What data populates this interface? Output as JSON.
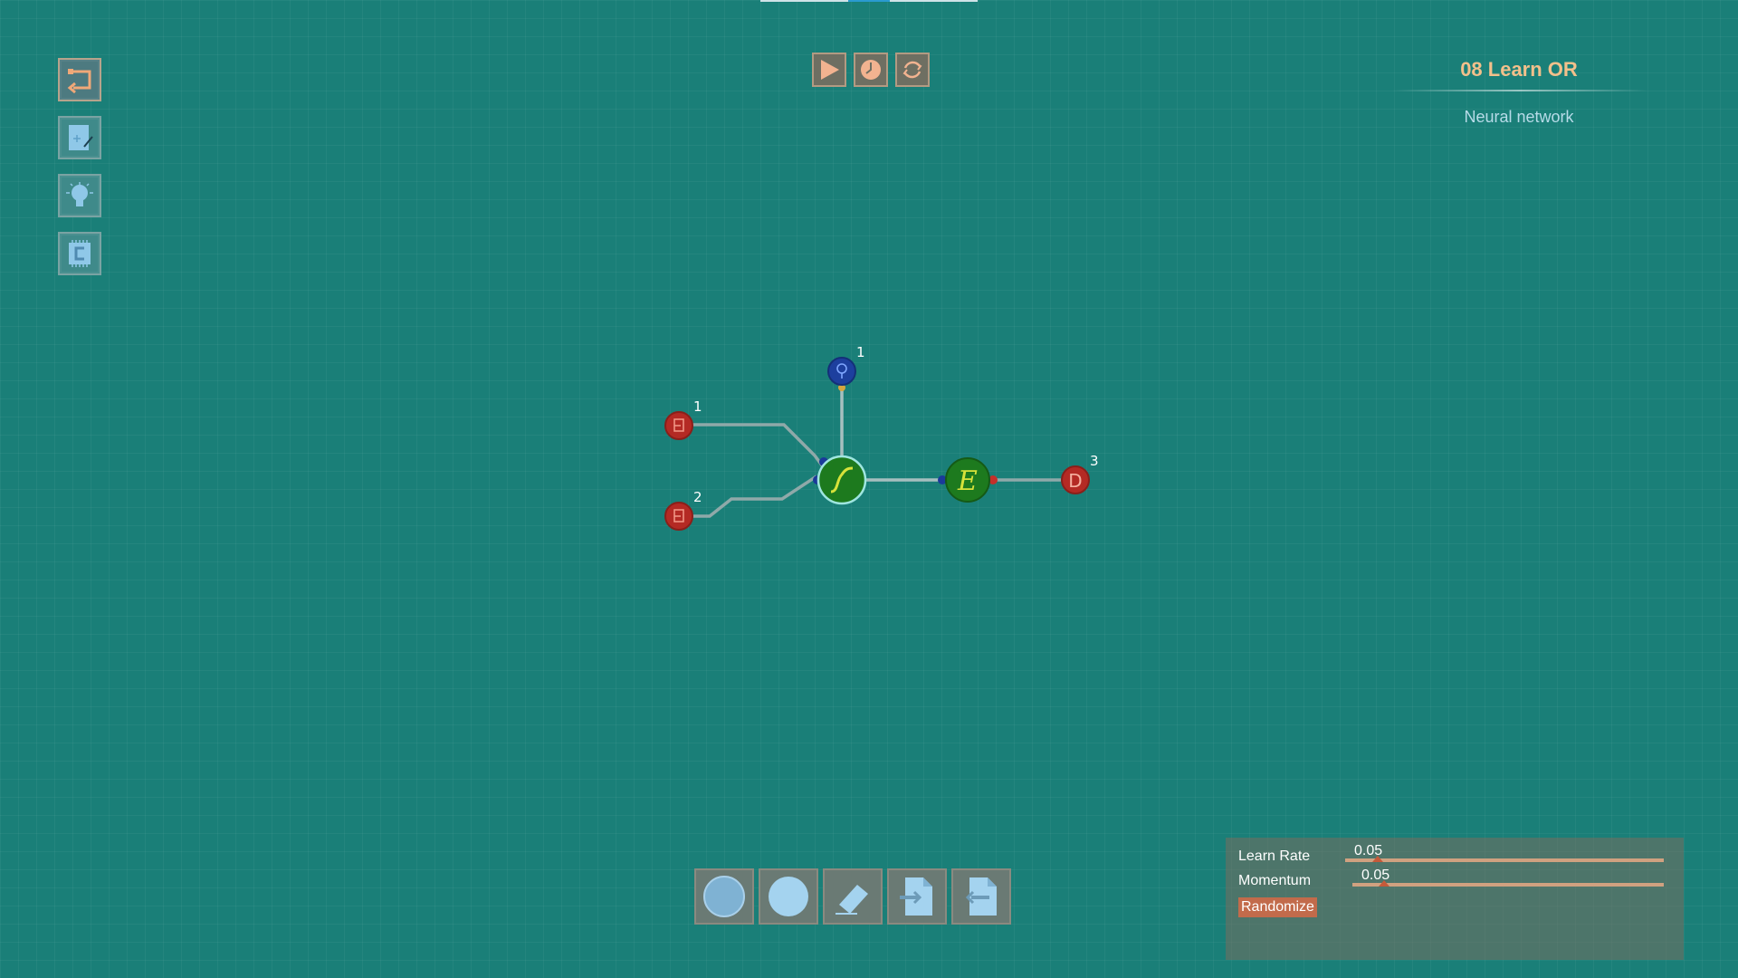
{
  "level": {
    "title": "08 Learn OR",
    "subtitle": "Neural network"
  },
  "toolbar_left": [
    {
      "name": "back",
      "icon": "back-arrow-icon"
    },
    {
      "name": "edit",
      "icon": "edit-document-icon"
    },
    {
      "name": "hint",
      "icon": "lightbulb-icon"
    },
    {
      "name": "chip",
      "icon": "chip-icon"
    }
  ],
  "toolbar_top": [
    {
      "name": "play",
      "icon": "play-icon"
    },
    {
      "name": "step",
      "icon": "clock-icon"
    },
    {
      "name": "reset",
      "icon": "refresh-icon"
    }
  ],
  "network": {
    "nodes": [
      {
        "id": "bias",
        "type": "bias",
        "label": "1",
        "icon": "bias-icon",
        "color": "#1d3f9e"
      },
      {
        "id": "input1",
        "type": "input",
        "label": "1",
        "icon": "input-icon",
        "color": "#b42a24"
      },
      {
        "id": "input2",
        "type": "input",
        "label": "2",
        "icon": "input-icon",
        "color": "#b42a24"
      },
      {
        "id": "sigmoid",
        "type": "neuron",
        "label": "",
        "icon": "sigmoid-icon",
        "color": "#1d7a1e"
      },
      {
        "id": "error",
        "type": "error",
        "label": "",
        "icon": "error-sum-icon",
        "color": "#1d7a1e"
      },
      {
        "id": "output",
        "type": "output",
        "label": "3",
        "icon": "output-icon",
        "color": "#b42a24"
      }
    ]
  },
  "palette": [
    {
      "name": "neuron",
      "icon": "neuron-ball-icon"
    },
    {
      "name": "bias",
      "icon": "bias-ball-icon"
    },
    {
      "name": "eraser",
      "icon": "eraser-icon"
    },
    {
      "name": "input-node",
      "icon": "input-doc-icon"
    },
    {
      "name": "output-node",
      "icon": "output-doc-icon"
    }
  ],
  "settings": {
    "learn_rate_label": "Learn Rate",
    "learn_rate_value": "0.05",
    "learn_rate": 0.05,
    "momentum_label": "Momentum",
    "momentum_value": "0.05",
    "momentum": 0.05,
    "randomize_label": "Randomize"
  },
  "colors": {
    "background": "#1a7f78",
    "accent": "#f3c08b",
    "button_border": "#b7a38c",
    "slider": "#d0a180"
  }
}
